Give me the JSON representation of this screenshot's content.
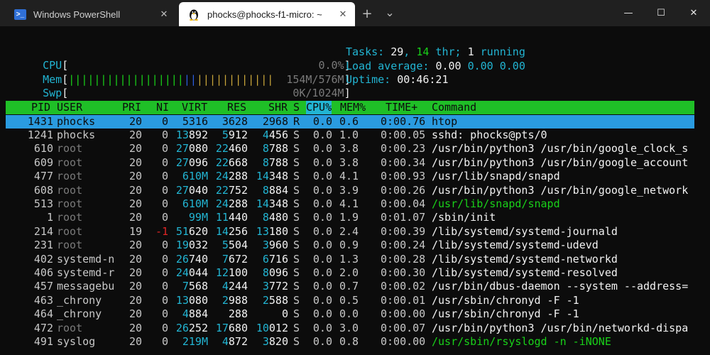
{
  "tabs": [
    {
      "label": "Windows PowerShell",
      "icon": "powershell-icon",
      "active": false
    },
    {
      "label": "phocks@phocks-f1-micro: ~",
      "icon": "linux-tux-icon",
      "active": true
    }
  ],
  "tab_close_glyph": "✕",
  "new_tab_glyph": "+",
  "dropdown_glyph": "⌄",
  "window_controls": {
    "minimize": "—",
    "maximize": "☐",
    "close": "✕"
  },
  "meters": {
    "cpu": {
      "label": "CPU",
      "open": "[",
      "close": "]",
      "value": "0.0%",
      "fraction": 0.0
    },
    "mem": {
      "label": "Mem",
      "open": "[",
      "close": "]",
      "value": "154M/576M",
      "fraction": 0.38
    },
    "swp": {
      "label": "Swp",
      "open": "[",
      "close": "]",
      "value": "0K/1024M",
      "fraction": 0.0
    }
  },
  "summary": {
    "tasks_label": "Tasks: ",
    "tasks": "29",
    "sep": ", ",
    "thr": "14",
    "thr_label": " thr; ",
    "running": "1",
    "running_label": " running",
    "load_label": "Load average: ",
    "load1": "0.00",
    "load5": "0.00",
    "load15": "0.00",
    "uptime_label": "Uptime: ",
    "uptime": "00:46:21"
  },
  "columns": [
    "PID",
    "USER",
    "PRI",
    "NI",
    "VIRT",
    "RES",
    "SHR",
    "S",
    "CPU%",
    "MEM%",
    "TIME+",
    "Command"
  ],
  "processes": [
    {
      "pid": "1431",
      "user": "phocks",
      "pri": "20",
      "ni": "0",
      "virt": "5316",
      "res": "3628",
      "shr": "2968",
      "s": "R",
      "cpu": "0.0",
      "mem": "0.6",
      "time": "0:00.76",
      "cmd": "htop",
      "selected": true
    },
    {
      "pid": "1241",
      "user": "phocks",
      "pri": "20",
      "ni": "0",
      "virt": "13892",
      "res": "5912",
      "shr": "4456",
      "s": "S",
      "cpu": "0.0",
      "mem": "1.0",
      "time": "0:00.05",
      "cmd": "sshd: phocks@pts/0"
    },
    {
      "pid": "610",
      "user": "root",
      "pri": "20",
      "ni": "0",
      "virt": "27080",
      "res": "22460",
      "shr": "8788",
      "s": "S",
      "cpu": "0.0",
      "mem": "3.8",
      "time": "0:00.23",
      "cmd": "/usr/bin/python3 /usr/bin/google_clock_s"
    },
    {
      "pid": "609",
      "user": "root",
      "pri": "20",
      "ni": "0",
      "virt": "27096",
      "res": "22668",
      "shr": "8788",
      "s": "S",
      "cpu": "0.0",
      "mem": "3.8",
      "time": "0:00.34",
      "cmd": "/usr/bin/python3 /usr/bin/google_account"
    },
    {
      "pid": "477",
      "user": "root",
      "pri": "20",
      "ni": "0",
      "virt": "610M",
      "res": "24288",
      "shr": "14348",
      "s": "S",
      "cpu": "0.0",
      "mem": "4.1",
      "time": "0:00.93",
      "cmd": "/usr/lib/snapd/snapd"
    },
    {
      "pid": "608",
      "user": "root",
      "pri": "20",
      "ni": "0",
      "virt": "27040",
      "res": "22752",
      "shr": "8884",
      "s": "S",
      "cpu": "0.0",
      "mem": "3.9",
      "time": "0:00.26",
      "cmd": "/usr/bin/python3 /usr/bin/google_network"
    },
    {
      "pid": "513",
      "user": "root",
      "pri": "20",
      "ni": "0",
      "virt": "610M",
      "res": "24288",
      "shr": "14348",
      "s": "S",
      "cpu": "0.0",
      "mem": "4.1",
      "time": "0:00.04",
      "cmd": "/usr/lib/snapd/snapd",
      "thread": true
    },
    {
      "pid": "1",
      "user": "root",
      "pri": "20",
      "ni": "0",
      "virt": "99M",
      "res": "11440",
      "shr": "8480",
      "s": "S",
      "cpu": "0.0",
      "mem": "1.9",
      "time": "0:01.07",
      "cmd": "/sbin/init"
    },
    {
      "pid": "214",
      "user": "root",
      "pri": "19",
      "ni": "-1",
      "virt": "51620",
      "res": "14256",
      "shr": "13180",
      "s": "S",
      "cpu": "0.0",
      "mem": "2.4",
      "time": "0:00.39",
      "cmd": "/lib/systemd/systemd-journald"
    },
    {
      "pid": "231",
      "user": "root",
      "pri": "20",
      "ni": "0",
      "virt": "19032",
      "res": "5504",
      "shr": "3960",
      "s": "S",
      "cpu": "0.0",
      "mem": "0.9",
      "time": "0:00.24",
      "cmd": "/lib/systemd/systemd-udevd"
    },
    {
      "pid": "402",
      "user": "systemd-n",
      "pri": "20",
      "ni": "0",
      "virt": "26740",
      "res": "7672",
      "shr": "6716",
      "s": "S",
      "cpu": "0.0",
      "mem": "1.3",
      "time": "0:00.28",
      "cmd": "/lib/systemd/systemd-networkd"
    },
    {
      "pid": "406",
      "user": "systemd-r",
      "pri": "20",
      "ni": "0",
      "virt": "24044",
      "res": "12100",
      "shr": "8096",
      "s": "S",
      "cpu": "0.0",
      "mem": "2.0",
      "time": "0:00.30",
      "cmd": "/lib/systemd/systemd-resolved"
    },
    {
      "pid": "457",
      "user": "messagebu",
      "pri": "20",
      "ni": "0",
      "virt": "7568",
      "res": "4244",
      "shr": "3772",
      "s": "S",
      "cpu": "0.0",
      "mem": "0.7",
      "time": "0:00.02",
      "cmd": "/usr/bin/dbus-daemon --system --address="
    },
    {
      "pid": "463",
      "user": "_chrony",
      "pri": "20",
      "ni": "0",
      "virt": "13080",
      "res": "2988",
      "shr": "2588",
      "s": "S",
      "cpu": "0.0",
      "mem": "0.5",
      "time": "0:00.01",
      "cmd": "/usr/sbin/chronyd -F -1"
    },
    {
      "pid": "464",
      "user": "_chrony",
      "pri": "20",
      "ni": "0",
      "virt": "4884",
      "res": "288",
      "shr": "0",
      "s": "S",
      "cpu": "0.0",
      "mem": "0.0",
      "time": "0:00.00",
      "cmd": "/usr/sbin/chronyd -F -1"
    },
    {
      "pid": "472",
      "user": "root",
      "pri": "20",
      "ni": "0",
      "virt": "26252",
      "res": "17680",
      "shr": "10012",
      "s": "S",
      "cpu": "0.0",
      "mem": "3.0",
      "time": "0:00.07",
      "cmd": "/usr/bin/python3 /usr/bin/networkd-dispa"
    },
    {
      "pid": "491",
      "user": "syslog",
      "pri": "20",
      "ni": "0",
      "virt": "219M",
      "res": "4872",
      "shr": "3820",
      "s": "S",
      "cpu": "0.0",
      "mem": "0.8",
      "time": "0:00.00",
      "cmd": "/usr/sbin/rsyslogd -n -iNONE",
      "thread": true
    }
  ]
}
